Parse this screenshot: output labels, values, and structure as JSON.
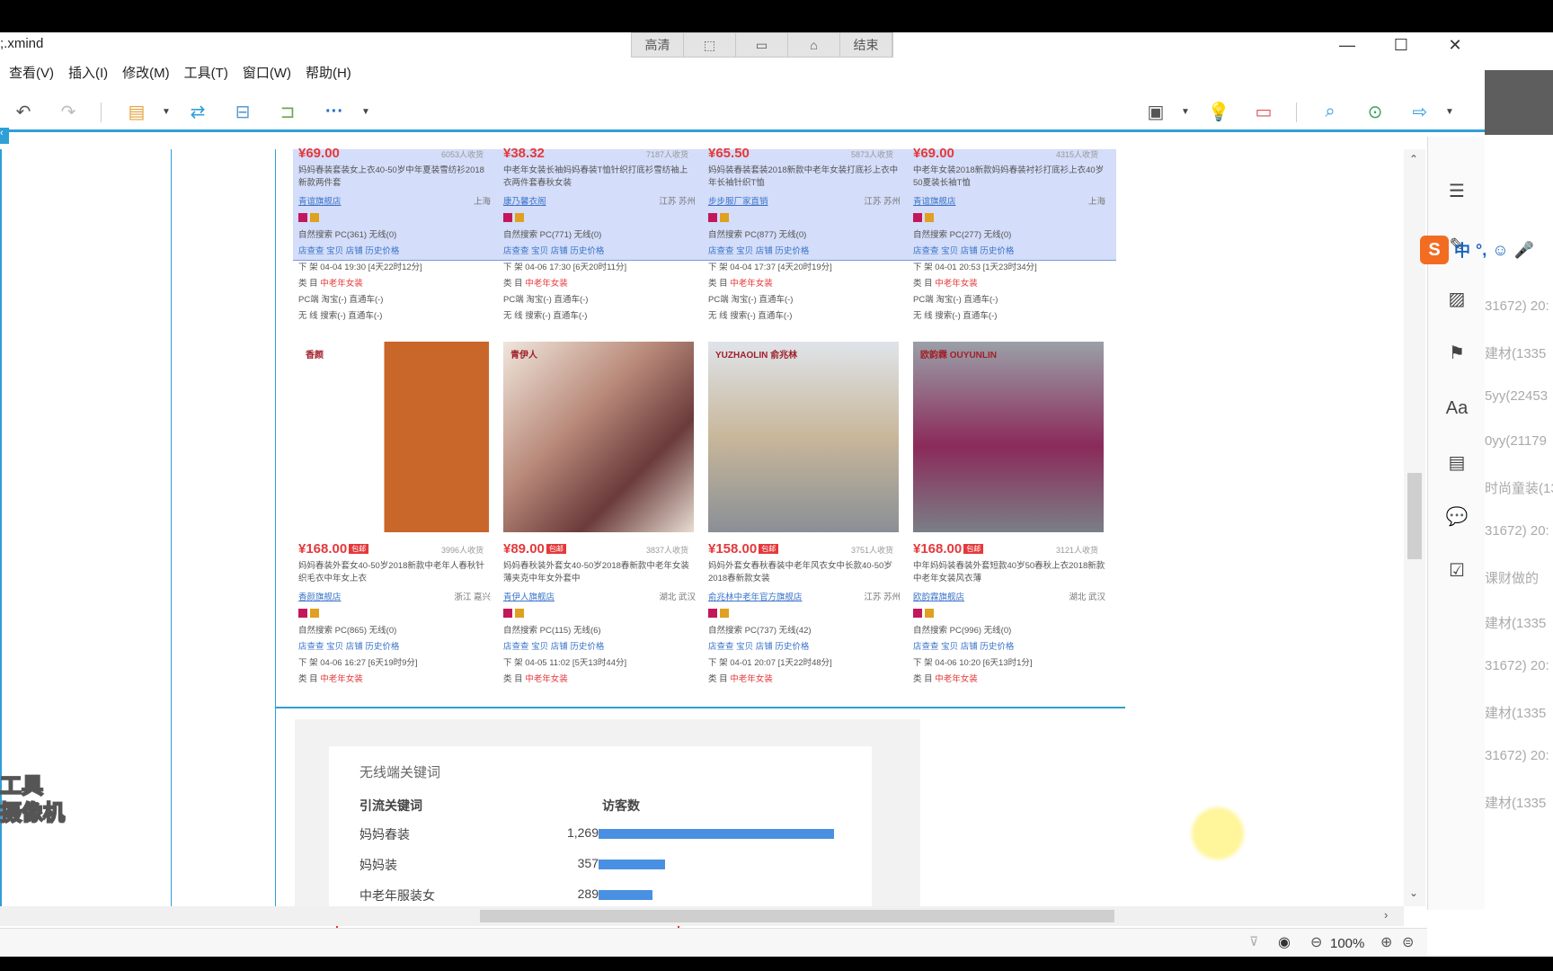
{
  "window": {
    "title": ";.xmind",
    "recorder_buttons": [
      "高清",
      "",
      "",
      "",
      "结束"
    ]
  },
  "menu": [
    "查看(V)",
    "插入(I)",
    "修改(M)",
    "工具(T)",
    "窗口(W)",
    "帮助(H)"
  ],
  "products_top": [
    {
      "price": "¥69.00",
      "buyers": "6053人收货",
      "title_plain": "妈妈春装套装女上衣40-50岁中年夏装雪纺衫2018新款两件套",
      "shop": "青谊旗舰店",
      "location": "上海",
      "stats": "自然搜索 PC(361) 无线(0)",
      "links": "店查查 宝贝 店铺 历史价格",
      "listing": "下 架 04-04 19:30 [4天22时12分]",
      "category_label": "类 目",
      "category": "中老年女装",
      "pc_line": "PC端 淘宝(-) 直通车(-)",
      "mobile_line": "无 线 搜索(-) 直通车(-)"
    },
    {
      "price": "¥38.32",
      "buyers": "7187人收货",
      "title_plain": "中老年女装长袖妈妈春装T恤针织打底衫雪纺袖上衣两件套春秋女装",
      "shop": "康乃馨衣阁",
      "location": "江苏 苏州",
      "stats": "自然搜索 PC(771) 无线(0)",
      "links": "店查查 宝贝 店铺 历史价格",
      "listing": "下 架 04-06 17:30 [6天20时11分]",
      "category_label": "类 目",
      "category": "中老年女装",
      "pc_line": "PC端 淘宝(-) 直通车(-)",
      "mobile_line": "无 线 搜索(-) 直通车(-)"
    },
    {
      "price": "¥65.50",
      "buyers": "5873人收货",
      "title_plain": "妈妈装春装套装2018新款中老年女装打底衫上衣中年长袖针织T恤",
      "shop": "步步服厂家直销",
      "location": "江苏 苏州",
      "stats": "自然搜索 PC(877) 无线(0)",
      "links": "店查查 宝贝 店铺 历史价格",
      "listing": "下 架 04-04 17:37 [4天20时19分]",
      "category_label": "类 目",
      "category": "中老年女装",
      "pc_line": "PC端 淘宝(-) 直通车(-)",
      "mobile_line": "无 线 搜索(-) 直通车(-)"
    },
    {
      "price": "¥69.00",
      "buyers": "4315人收货",
      "title_plain": "中老年女装2018新款妈妈春装衬衫打底衫上衣40岁50夏装长袖T恤",
      "shop": "青谊旗舰店",
      "location": "上海",
      "stats": "自然搜索 PC(277) 无线(0)",
      "links": "店查查 宝贝 店铺 历史价格",
      "listing": "下 架 04-01 20:53 [1天23时34分]",
      "category_label": "类 目",
      "category": "中老年女装",
      "pc_line": "PC端 淘宝(-) 直通车(-)",
      "mobile_line": "无 线 搜索(-) 直通车(-)"
    }
  ],
  "products_bottom": [
    {
      "photo_label": "香颜",
      "price": "¥168.00",
      "badge": "包邮",
      "buyers": "3996人收货",
      "title": "妈妈春装外套女40-50岁2018新款中老年人春秋针织毛衣中年女上衣",
      "shop": "香颜旗舰店",
      "location": "浙江 嘉兴",
      "stats": "自然搜索 PC(865) 无线(0)",
      "links": "店查查 宝贝 店铺 历史价格",
      "listing": "下 架 04-06 16:27 [6天19时9分]",
      "category_label": "类 目",
      "category": "中老年女装"
    },
    {
      "photo_label": "青伊人",
      "price": "¥89.00",
      "badge": "包邮",
      "buyers": "3837人收货",
      "title": "妈妈春秋装外套女40-50岁2018春新款中老年女装薄夹克中年女外套中",
      "shop": "青伊人旗舰店",
      "location": "湖北 武汉",
      "stats": "自然搜索 PC(115) 无线(6)",
      "links": "店查查 宝贝 店铺 历史价格",
      "listing": "下 架 04-05 11:02 [5天13时44分]",
      "category_label": "类 目",
      "category": "中老年女装"
    },
    {
      "photo_label": "YUZHAOLIN 俞兆林",
      "price": "¥158.00",
      "badge": "包邮",
      "buyers": "3751人收货",
      "title": "妈妈外套女春秋春装中老年风衣女中长款40-50岁2018春新款女装",
      "shop": "俞兆林中老年官方旗舰店",
      "location": "江苏 苏州",
      "stats": "自然搜索 PC(737) 无线(42)",
      "links": "店查查 宝贝 店铺 历史价格",
      "listing": "下 架 04-01 20:07 [1天22时48分]",
      "category_label": "类 目",
      "category": "中老年女装"
    },
    {
      "photo_label": "欧韵霖 OUYUNLIN",
      "price": "¥168.00",
      "badge": "包邮",
      "buyers": "3121人收货",
      "title": "中年妈妈装春装外套短款40岁50春秋上衣2018新款中老年女装风衣薄",
      "shop": "欧韵霖旗舰店",
      "location": "湖北 武汉",
      "stats": "自然搜索 PC(996) 无线(0)",
      "links": "店查查 宝贝 店铺 历史价格",
      "listing": "下 架 04-06 10:20 [6天13时1分]",
      "category_label": "类 目",
      "category": "中老年女装"
    }
  ],
  "keywords": {
    "title": "无线端关键词",
    "col_keyword": "引流关键词",
    "col_visitors": "访客数",
    "rows": [
      {
        "keyword": "妈妈春装",
        "visitors": "1,269",
        "value": 1269
      },
      {
        "keyword": "妈妈装",
        "visitors": "357",
        "value": 357
      },
      {
        "keyword": "中老年服装女",
        "visitors": "289",
        "value": 289
      }
    ]
  },
  "status": {
    "zoom": "100%"
  },
  "overlay": {
    "line1": "工具",
    "line2": "摄像机"
  },
  "right_strip_lines": [
    "31672) 20:",
    "建材(1335",
    "5yy(22453",
    "0yy(21179",
    "时尚童装(13",
    "31672) 20:",
    "课财做的",
    "建材(1335",
    "31672) 20:",
    "建材(1335",
    "31672) 20:",
    "建材(1335"
  ],
  "ime": {
    "label": "中",
    "punct": "°,"
  },
  "colors": {
    "accent": "#2f9fd8",
    "price": "#e4393c",
    "bar": "#4a90e2",
    "highlight_box": "#e23131"
  }
}
